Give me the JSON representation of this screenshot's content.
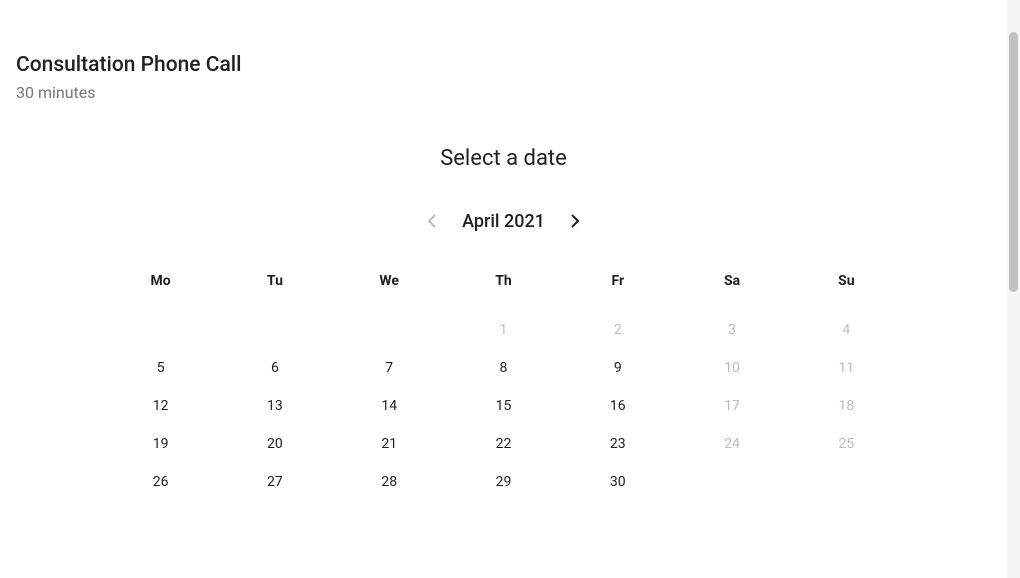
{
  "header": {
    "title": "Consultation Phone Call",
    "duration": "30 minutes"
  },
  "select_label": "Select a date",
  "month_nav": {
    "label": "April 2021"
  },
  "weekdays": [
    "Mo",
    "Tu",
    "We",
    "Th",
    "Fr",
    "Sa",
    "Su"
  ],
  "days": [
    {
      "n": "",
      "enabled": false,
      "empty": true
    },
    {
      "n": "",
      "enabled": false,
      "empty": true
    },
    {
      "n": "",
      "enabled": false,
      "empty": true
    },
    {
      "n": "1",
      "enabled": false,
      "empty": false
    },
    {
      "n": "2",
      "enabled": false,
      "empty": false
    },
    {
      "n": "3",
      "enabled": false,
      "empty": false
    },
    {
      "n": "4",
      "enabled": false,
      "empty": false
    },
    {
      "n": "5",
      "enabled": true,
      "empty": false
    },
    {
      "n": "6",
      "enabled": true,
      "empty": false
    },
    {
      "n": "7",
      "enabled": true,
      "empty": false
    },
    {
      "n": "8",
      "enabled": true,
      "empty": false
    },
    {
      "n": "9",
      "enabled": true,
      "empty": false
    },
    {
      "n": "10",
      "enabled": false,
      "empty": false
    },
    {
      "n": "11",
      "enabled": false,
      "empty": false
    },
    {
      "n": "12",
      "enabled": true,
      "empty": false
    },
    {
      "n": "13",
      "enabled": true,
      "empty": false
    },
    {
      "n": "14",
      "enabled": true,
      "empty": false
    },
    {
      "n": "15",
      "enabled": true,
      "empty": false
    },
    {
      "n": "16",
      "enabled": true,
      "empty": false
    },
    {
      "n": "17",
      "enabled": false,
      "empty": false
    },
    {
      "n": "18",
      "enabled": false,
      "empty": false
    },
    {
      "n": "19",
      "enabled": true,
      "empty": false
    },
    {
      "n": "20",
      "enabled": true,
      "empty": false
    },
    {
      "n": "21",
      "enabled": true,
      "empty": false
    },
    {
      "n": "22",
      "enabled": true,
      "empty": false
    },
    {
      "n": "23",
      "enabled": true,
      "empty": false
    },
    {
      "n": "24",
      "enabled": false,
      "empty": false
    },
    {
      "n": "25",
      "enabled": false,
      "empty": false
    },
    {
      "n": "26",
      "enabled": true,
      "empty": false
    },
    {
      "n": "27",
      "enabled": true,
      "empty": false
    },
    {
      "n": "28",
      "enabled": true,
      "empty": false
    },
    {
      "n": "29",
      "enabled": true,
      "empty": false
    },
    {
      "n": "30",
      "enabled": true,
      "empty": false
    },
    {
      "n": "",
      "enabled": false,
      "empty": true
    },
    {
      "n": "",
      "enabled": false,
      "empty": true
    }
  ]
}
